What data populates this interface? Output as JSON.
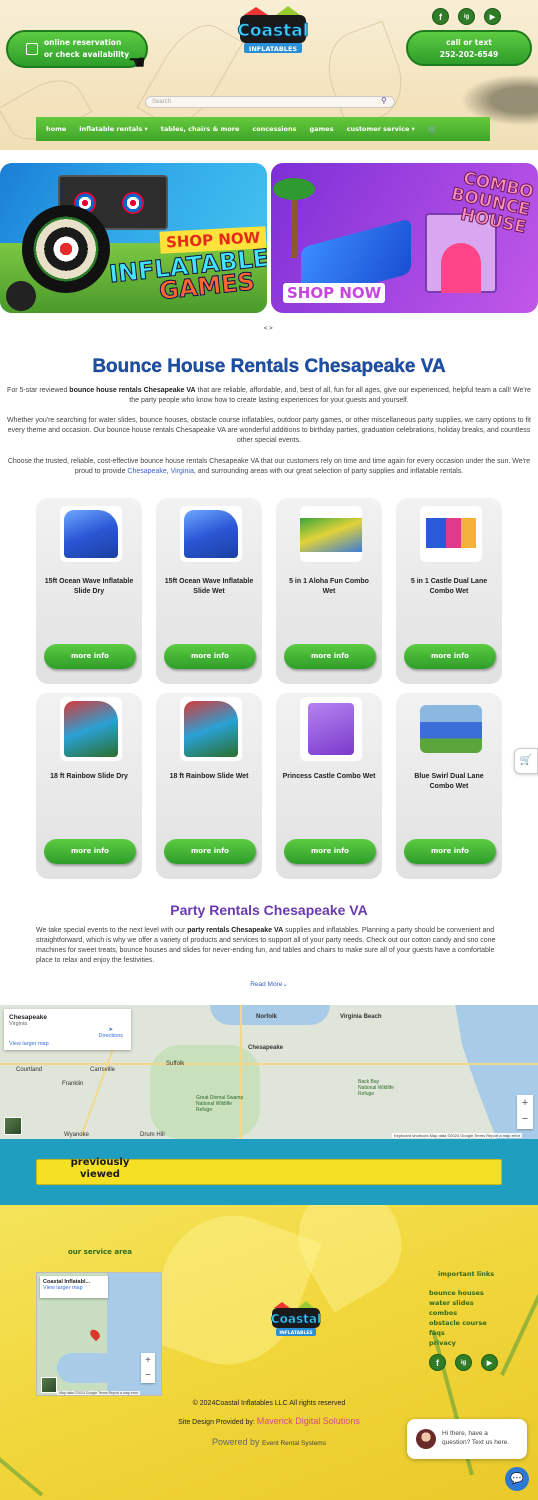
{
  "header": {
    "reserve_line1": "Online Reservation",
    "reserve_line2": "Or Check Availability",
    "call_line1": "Call or Text",
    "call_line2": "252-202-6549",
    "logo_text": "Coastal",
    "logo_sub": "INFLATABLES",
    "social": [
      "f",
      "ig",
      "▶"
    ],
    "search_placeholder": "Search"
  },
  "nav": {
    "items": [
      "Home",
      "Inflatable Rentals ▾",
      "Tables, Chairs & More",
      "Concessions",
      "Games",
      "Customer Service ▾"
    ],
    "cart_icon": "🛒"
  },
  "banners": {
    "banner1": {
      "shop": "SHOP NOW",
      "line1": "INFLATABLE",
      "line2": "GAMES"
    },
    "banner2": {
      "combo": "COMBO",
      "bounce": "BOUNCE HOUSE",
      "shop": "SHOP NOW"
    },
    "arrows": "< >"
  },
  "main": {
    "title": "Bounce House Rentals Chesapeake VA",
    "p1_pre": "For 5-star reviewed ",
    "p1_bold": "bounce house rentals Chesapeake VA",
    "p1_post": " that are reliable, affordable, and, best of all, fun for all ages, give our experienced, helpful team a call! We're the party people who know how to create lasting experiences for your guests and yourself.",
    "p2": "Whether you're searching for water slides, bounce houses, obstacle course inflatables, outdoor party games, or other miscellaneous party supplies, we carry options to fit every theme and occasion. Our bounce house rentals Chesapeake VA are wonderful additions to birthday parties, graduation celebrations, holiday breaks, and countless other special events.",
    "p3_pre": "Choose the trusted, reliable, cost-effective bounce house rentals Chesapeake VA that our customers rely on time and time again for every occasion under the sun. We're proud to provide ",
    "p3_link1": "Chesapeake",
    "p3_sep": ", ",
    "p3_link2": "Virginia",
    "p3_post": ", and surrounding areas with our great selection of party supplies and inflatable rentals."
  },
  "products": [
    {
      "name": "15ft Ocean Wave Inflatable Slide Dry",
      "btn": "More Info"
    },
    {
      "name": "15ft Ocean Wave Inflatable Slide Wet",
      "btn": "More Info"
    },
    {
      "name": "5 in 1 Aloha Fun Combo Wet",
      "btn": "More Info"
    },
    {
      "name": "5 in 1 Castle Dual Lane Combo Wet",
      "btn": "More Info"
    },
    {
      "name": "18 ft Rainbow Slide Dry",
      "btn": "More Info"
    },
    {
      "name": "18 ft Rainbow Slide Wet",
      "btn": "More Info"
    },
    {
      "name": "Princess Castle Combo Wet",
      "btn": "More Info"
    },
    {
      "name": "Blue Swirl Dual Lane Combo Wet",
      "btn": "More Info"
    }
  ],
  "party": {
    "title": "Party Rentals Chesapeake VA",
    "p_pre": "We take special events to the next level with our ",
    "p_bold": "party rentals Chesapeake VA",
    "p_post": " supplies and inflatables. Planning a party should be convenient and straightforward, which is why we offer a variety of products and services to support all of your party needs. Check out our cotton candy and sno cone machines for sweet treats, bounce houses and slides for never-ending fun, and tables and chairs to make sure all of your guests have a comfortable place to relax and enjoy the festivities.",
    "read_more": "Read More"
  },
  "map": {
    "place": "Chesapeake",
    "state": "Virginia",
    "larger": "View larger map",
    "directions": "Directions",
    "labels": [
      "Norfolk",
      "Virginia Beach",
      "Chesapeake",
      "Suffolk",
      "Franklin",
      "Courtland",
      "Carrsville",
      "Wyanoke",
      "Drum Hill",
      "Great Dismal Swamp National Wildlife Refuge",
      "Back Bay National Wildlife Refuge"
    ],
    "footer": "Keyboard shortcuts   Map data ©2024 Google   Terms   Report a map error"
  },
  "previously": {
    "title": "Previously Viewed"
  },
  "footer": {
    "service_title": "Our Service Area",
    "mini_place": "Coastal Inflatabl...",
    "mini_larger": "View larger map",
    "mini_footer": "Map data ©2024 Google   Terms   Report a map error",
    "links_title": "Important Links",
    "links": [
      "Bounce Houses",
      "Water Slides",
      "Combos",
      "Obstacle Course",
      "FAQs",
      "Privacy"
    ],
    "copyright": "© 2024Coastal Inflatables LLC All rights reserved",
    "design_pre": "Site Design Provided by: ",
    "design_link": "Maverick Digital Solutions",
    "powered_pre": "Powered by ",
    "powered_link": "Event Rental Systems"
  },
  "chat": {
    "line1": "Hi there, have a",
    "line2": "question? Text us here."
  }
}
